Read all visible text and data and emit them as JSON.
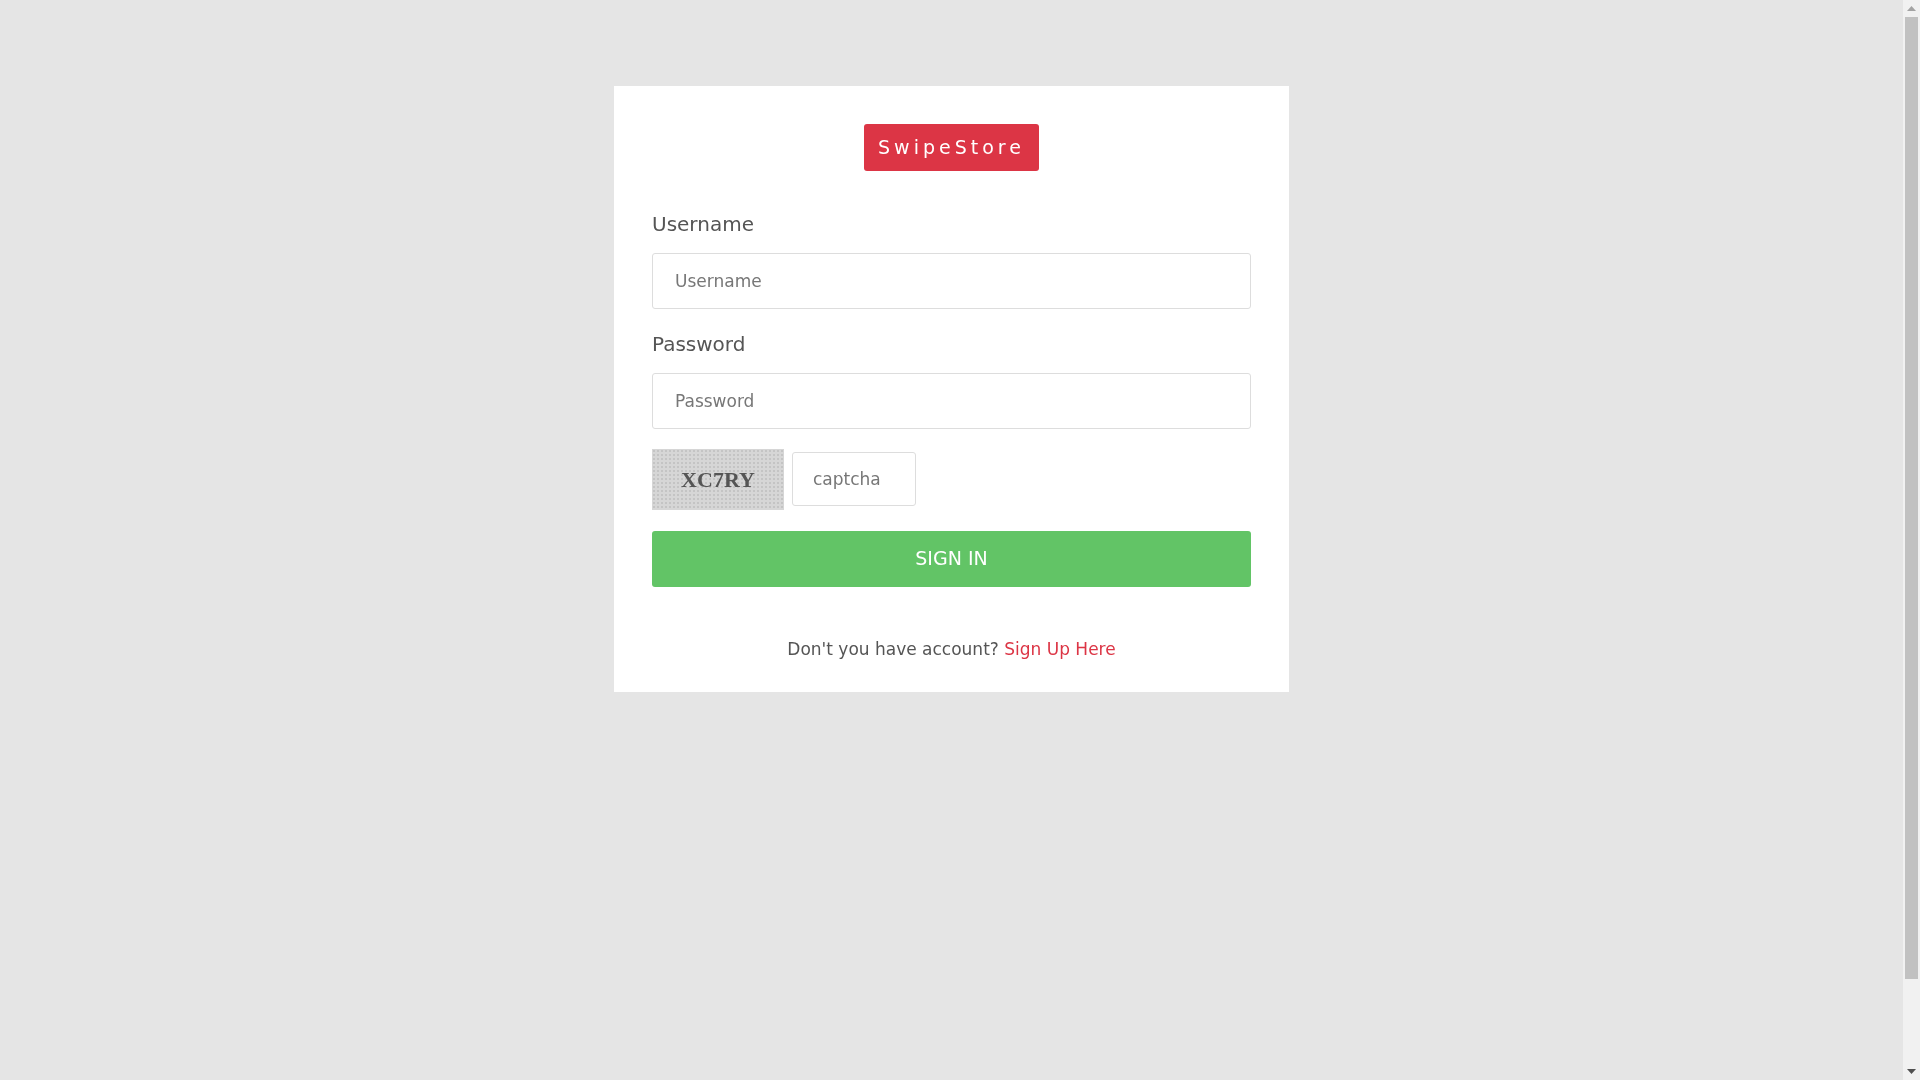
{
  "brand": "SwipeStore",
  "fields": [
    {
      "label": "Username",
      "placeholder": "Username"
    },
    {
      "label": "Password",
      "placeholder": "Password"
    }
  ],
  "captcha": {
    "image_text": "XC7RY",
    "placeholder": "captcha"
  },
  "submit": "SIGN IN",
  "footer": {
    "text": "Don't you have account?",
    "link": "Sign Up Here"
  }
}
